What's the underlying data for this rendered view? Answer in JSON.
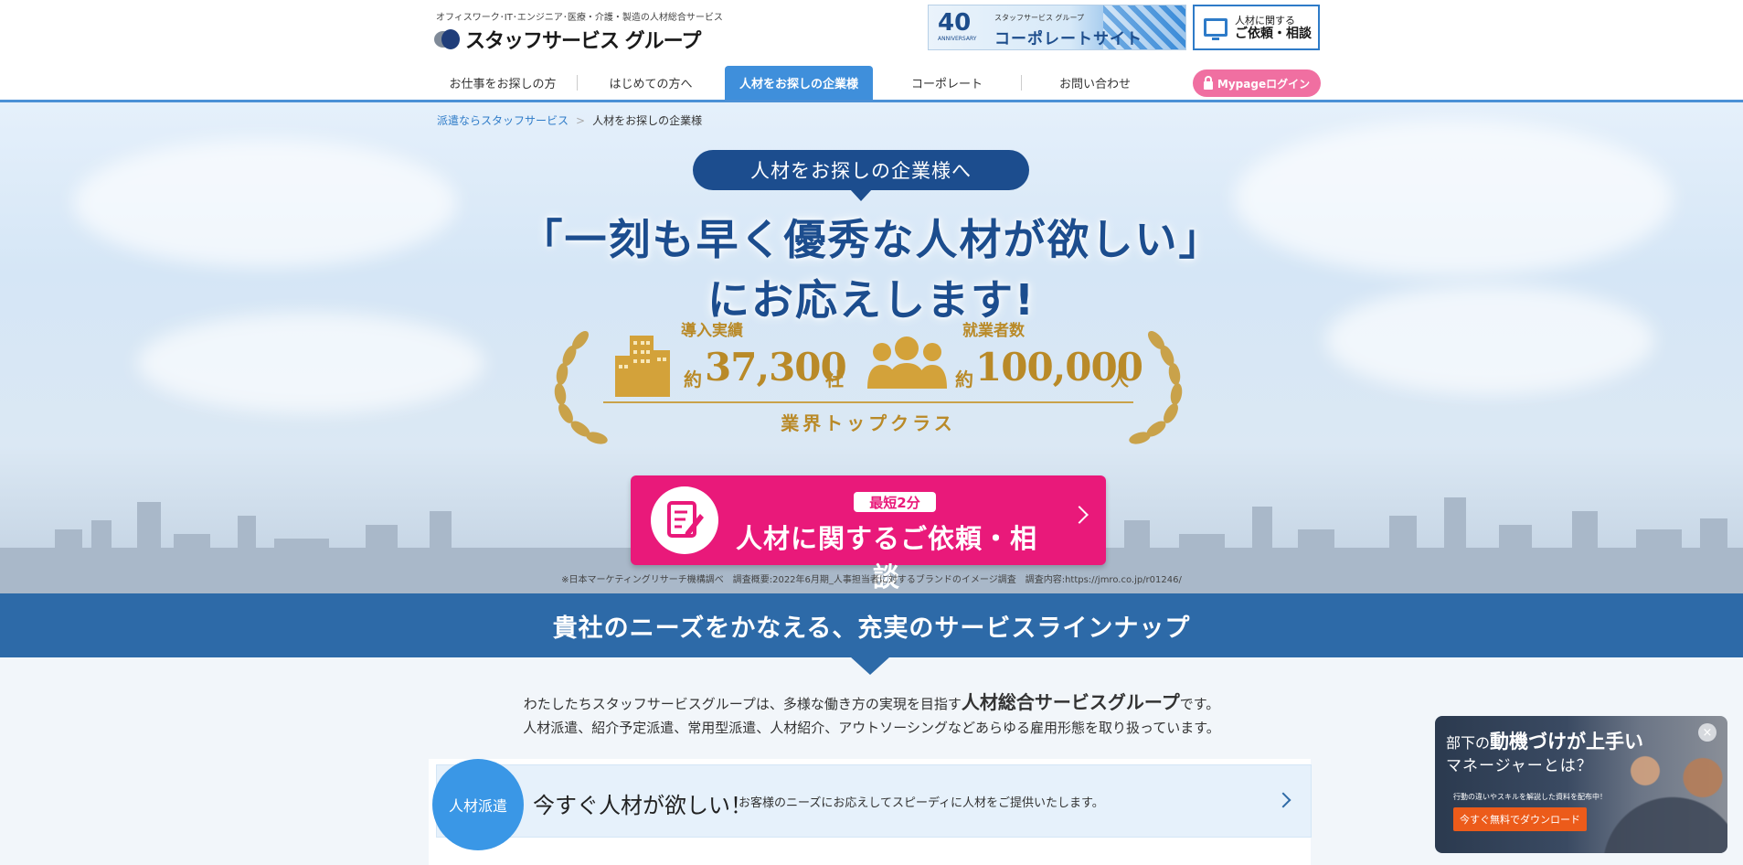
{
  "header": {
    "tagline": "オフィスワーク･IT･エンジニア･医療・介護・製造の人材総合サービス",
    "logo_text": "スタッフサービス グループ",
    "corporate_banner": {
      "number": "40",
      "anniversary": "ANNIVERSARY",
      "group": "スタッフサービス グループ",
      "label": "コーポレートサイト"
    },
    "consult": {
      "line1": "人材に関する",
      "line2": "ご依頼・相談"
    },
    "nav": [
      {
        "label": "お仕事をお探しの方"
      },
      {
        "label": "はじめての方へ"
      },
      {
        "label": "人材をお探しの企業様",
        "active": true
      },
      {
        "label": "コーポレート"
      },
      {
        "label": "お問い合わせ"
      }
    ],
    "mypage_label": "Mypageログイン"
  },
  "breadcrumb": {
    "home": "派遣ならスタッフサービス",
    "current": "人材をお探しの企業様"
  },
  "hero": {
    "pill": "人材をお探しの企業様へ",
    "headline1": "「一刻も早く優秀な人材が欲しい」",
    "headline2": "にお応えします!",
    "stats": [
      {
        "label": "導入実績",
        "prefix": "約",
        "value": "37,300",
        "unit": "社"
      },
      {
        "label": "就業者数",
        "prefix": "約",
        "value": "100,000",
        "unit": "人"
      }
    ],
    "award_class": "業界トップクラス",
    "cta": {
      "badge": "最短2分",
      "label": "人材に関するご依頼・相談"
    },
    "note": "※日本マーケティングリサーチ機構調べ　調査概要:2022年6月期_人事担当者に対するブランドのイメージ調査　調査内容:https://jmro.co.jp/r01246/"
  },
  "services": {
    "band_title": "貴社のニーズをかなえる、充実のサービスラインナップ",
    "intro_before": "わたしたちスタッフサービスグループは、多様な働き方の実現を目指す",
    "intro_bold": "人材総合サービスグループ",
    "intro_after": "です。",
    "intro2": "人材派遣、紹介予定派遣、常用型派遣、人材紹介、アウトソーシングなどあらゆる雇用形態を取り扱っています。",
    "items": [
      {
        "badge": "人材派遣",
        "title": "今すぐ人材が欲しい！",
        "desc": "お客様のニーズにお応えしてスピーディに人材をご提供いたします。"
      }
    ]
  },
  "popup": {
    "line1_pre": "部下の",
    "line1_bold": "動機づけが上手い",
    "line2": "マネージャーとは？",
    "small": "行動の違いやスキルを解説した資料を配布中！",
    "button": "今すぐ無料でダウンロード",
    "close": "×"
  },
  "colors": {
    "brand_blue": "#1c4d8e",
    "nav_active": "#3f8fdb",
    "cta_pink": "#e9197a",
    "gold": "#b98a28",
    "mypage_pink": "#f06fa1"
  }
}
